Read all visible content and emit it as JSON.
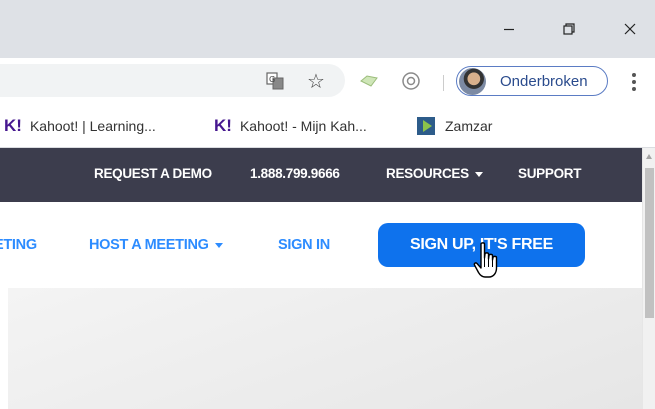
{
  "window": {
    "minimize_icon": "minimize-icon",
    "maximize_icon": "restore-icon",
    "close_icon": "close-icon"
  },
  "toolbar": {
    "icons": [
      "translate-icon",
      "star-icon",
      "extension-icon",
      "extension-icon",
      "menu-icon"
    ],
    "profile_label": "Onderbroken",
    "profile_border_color": "#5b7cc4"
  },
  "bookmarks": [
    {
      "icon": "kahoot-icon",
      "icon_text": "K!",
      "label": "Kahoot! | Learning..."
    },
    {
      "icon": "kahoot-icon",
      "icon_text": "K!",
      "label": "Kahoot! - Mijn Kah..."
    },
    {
      "icon": "zamzar-icon",
      "label": "Zamzar"
    }
  ],
  "site": {
    "topnav": {
      "request_demo": "REQUEST A DEMO",
      "phone": "1.888.799.9666",
      "resources": "RESOURCES",
      "support": "SUPPORT",
      "bg_color": "#3c3d4d"
    },
    "mainnav": {
      "join_partial": "ETING",
      "host": "HOST A MEETING",
      "sign_in": "SIGN IN",
      "sign_up": "SIGN UP, IT'S FREE",
      "link_color": "#2d8cff",
      "button_color": "#0e72ed"
    }
  },
  "cursor": "hand-pointer-icon"
}
